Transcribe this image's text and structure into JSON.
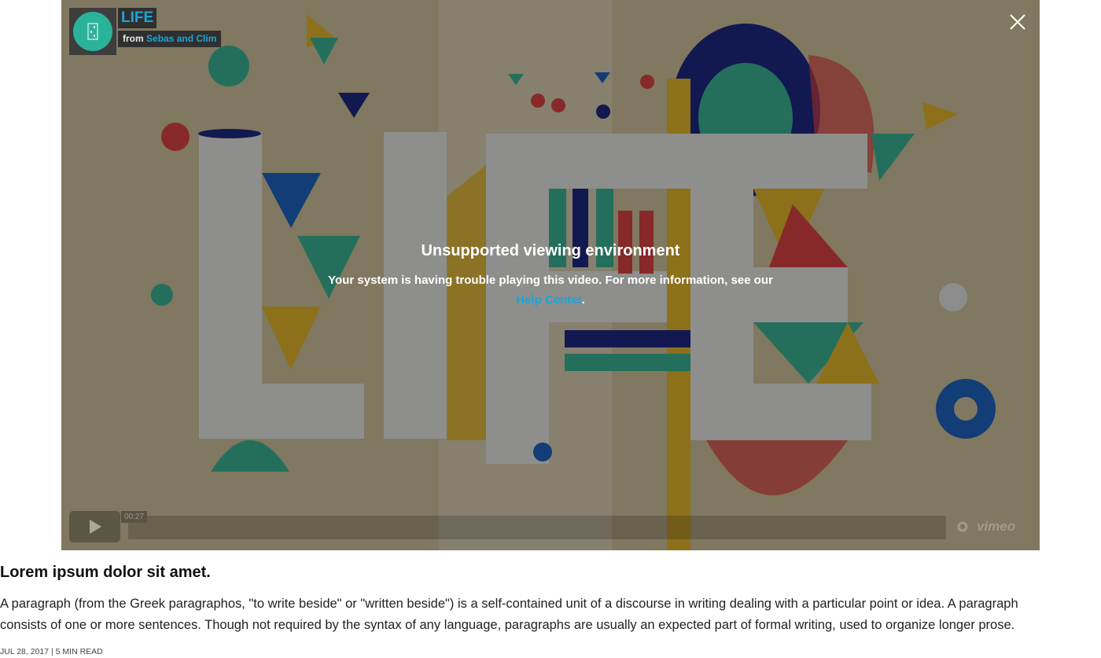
{
  "player": {
    "video_title": "LIFE",
    "byline_prefix": "from",
    "author": "Sebas and Clim",
    "timecode": "00:27",
    "vimeo_label": "vimeo",
    "error": {
      "title": "Unsupported viewing environment",
      "message": "Your system is having trouble playing this video. For more information, see our",
      "link_label": "Help Center",
      "suffix": "."
    },
    "colors": {
      "accent": "#1aa6d8",
      "badge": "#2bb39a",
      "poster_background": "#d8cdb0"
    },
    "icons": {
      "close": "close-icon",
      "play": "play-icon",
      "settings": "gear-icon"
    }
  },
  "article": {
    "title": "Lorem ipsum dolor sit amet.",
    "body": "A paragraph (from the Greek paragraphos, \"to write beside\" or \"written beside\") is a self-contained unit of a discourse in writing dealing with a particular point or idea. A paragraph consists of one or more sentences. Though not required by the syntax of any language, paragraphs are usually an expected part of formal writing, used to organize longer prose.",
    "date": "JUL 28, 2017",
    "separator": "|",
    "read_time": "5 MIN READ"
  }
}
